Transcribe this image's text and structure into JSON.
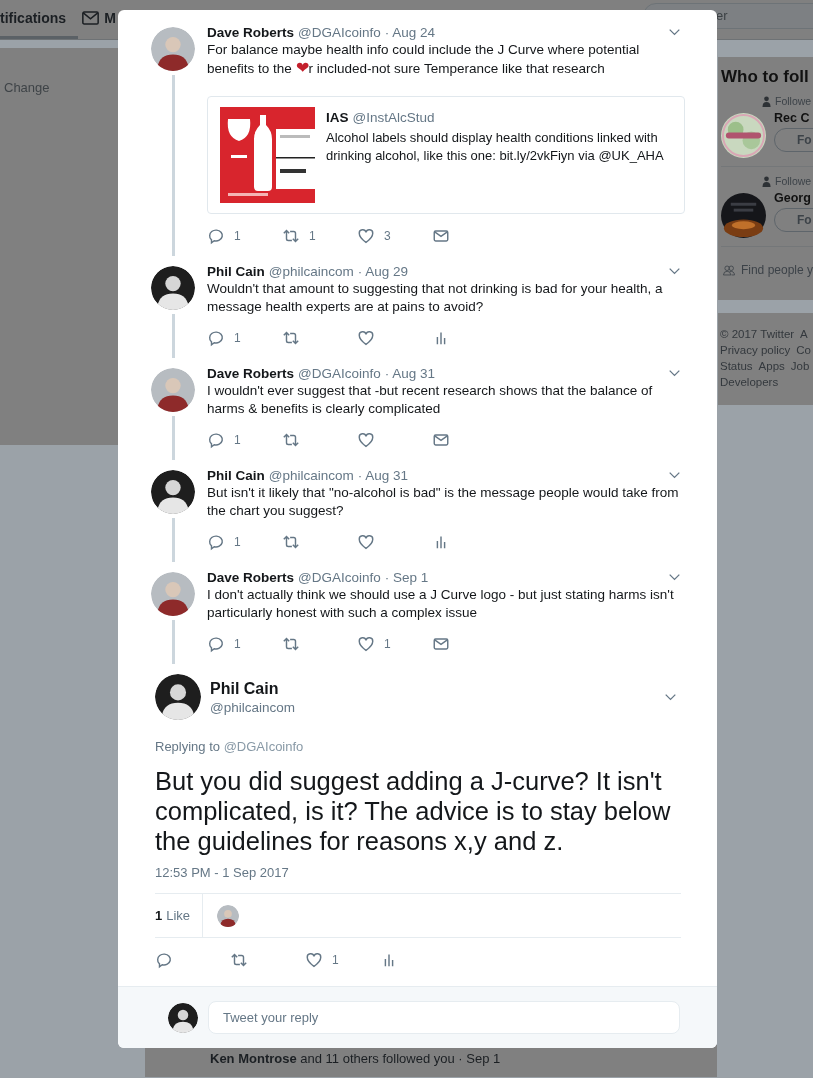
{
  "nav": {
    "tabs": [
      {
        "label": "tifications",
        "kind": "plain",
        "selected": true
      },
      {
        "label": "M",
        "kind": "mail",
        "selected": false
      }
    ],
    "search": {
      "placeholder": "er"
    }
  },
  "left_panel": {
    "link": "Change"
  },
  "who_to_follow": {
    "title": "Who to foll",
    "suggestions": [
      {
        "context": "Followe",
        "name": "Rec C",
        "button": "Fo"
      },
      {
        "context": "Followe",
        "name": "Georg",
        "button": "Fo"
      }
    ],
    "find_people": "Find people y"
  },
  "footer_links": [
    [
      "© 2017 Twitter",
      "A"
    ],
    [
      "Privacy policy",
      "Co"
    ],
    [
      "Status",
      "Apps",
      "Job"
    ],
    [
      "Developers"
    ]
  ],
  "notification": "**Ken Montrose** and 11 others followed you · Sep 1",
  "modal": {
    "thread": [
      {
        "name": "Dave Roberts",
        "handle": "@DGAIcoinfo",
        "date": "· Aug 24",
        "avatar": {
          "kind": "light"
        },
        "parts": [
          {
            "kind": "text",
            "text": "For balance maybe health info could include the J Curve where potential benefits to the "
          },
          {
            "kind": "emoji",
            "text": "❤"
          },
          {
            "kind": "text",
            "text": "r included-not sure Temperance like that research"
          }
        ],
        "quote": {
          "name": "IAS",
          "handle": "@InstAlcStud",
          "text": "Alcohol labels should display health conditions linked with drinking alcohol, like this one: bit.ly/2vkFiyn via @UK_AHA"
        },
        "actions": [
          {
            "kind": "reply",
            "count": "1"
          },
          {
            "kind": "retweet",
            "count": "1"
          },
          {
            "kind": "like",
            "count": "3"
          },
          {
            "kind": "message"
          }
        ]
      },
      {
        "name": "Phil Cain",
        "handle": "@philcaincom",
        "date": "· Aug 29",
        "avatar": {
          "kind": "dark"
        },
        "parts": [
          {
            "kind": "text",
            "text": "Wouldn't that amount to suggesting that not drinking is bad for your health, a message health experts are at pains to avoid?"
          }
        ],
        "actions": [
          {
            "kind": "reply",
            "count": "1"
          },
          {
            "kind": "retweet"
          },
          {
            "kind": "like"
          },
          {
            "kind": "stats"
          }
        ]
      },
      {
        "name": "Dave Roberts",
        "handle": "@DGAIcoinfo",
        "date": "· Aug 31",
        "avatar": {
          "kind": "light"
        },
        "parts": [
          {
            "kind": "text",
            "text": "I wouldn't ever suggest that -but recent research shows that the balance of harms & benefits is clearly complicated"
          }
        ],
        "actions": [
          {
            "kind": "reply",
            "count": "1"
          },
          {
            "kind": "retweet"
          },
          {
            "kind": "like"
          },
          {
            "kind": "message"
          }
        ]
      },
      {
        "name": "Phil Cain",
        "handle": "@philcaincom",
        "date": "· Aug 31",
        "avatar": {
          "kind": "dark"
        },
        "parts": [
          {
            "kind": "text",
            "text": "But isn't it likely that \"no-alcohol is bad\" is the message people would take from the chart you suggest?"
          }
        ],
        "actions": [
          {
            "kind": "reply",
            "count": "1"
          },
          {
            "kind": "retweet"
          },
          {
            "kind": "like"
          },
          {
            "kind": "stats"
          }
        ]
      },
      {
        "name": "Dave Roberts",
        "handle": "@DGAIcoinfo",
        "date": "· Sep 1",
        "avatar": {
          "kind": "light"
        },
        "parts": [
          {
            "kind": "text",
            "text": "I don't actually think we should use a J Curve logo - but just stating harms isn't particularly honest with such a complex issue"
          }
        ],
        "actions": [
          {
            "kind": "reply",
            "count": "1"
          },
          {
            "kind": "retweet"
          },
          {
            "kind": "like",
            "count": "1"
          },
          {
            "kind": "message"
          }
        ]
      }
    ],
    "focus": {
      "name": "Phil Cain",
      "handle": "@philcaincom",
      "avatar": {
        "kind": "dark"
      },
      "replying_to": {
        "text": "Replying to",
        "handle": "@DGAIcoinfo"
      },
      "text": "But you did suggest adding a J-curve? It isn't complicated, is it? The advice is to stay below the guidelines for reasons x,y and z.",
      "timestamp": "12:53 PM - 1 Sep 2017",
      "likes": {
        "count": "1",
        "label": "Like"
      },
      "likers": [
        {
          "avatar": {
            "kind": "light"
          }
        }
      ],
      "actions": [
        {
          "kind": "reply"
        },
        {
          "kind": "retweet"
        },
        {
          "kind": "like",
          "count": "1"
        },
        {
          "kind": "stats"
        }
      ]
    },
    "reply_box": {
      "placeholder": "Tweet your reply",
      "avatar": {
        "kind": "dark"
      }
    }
  }
}
